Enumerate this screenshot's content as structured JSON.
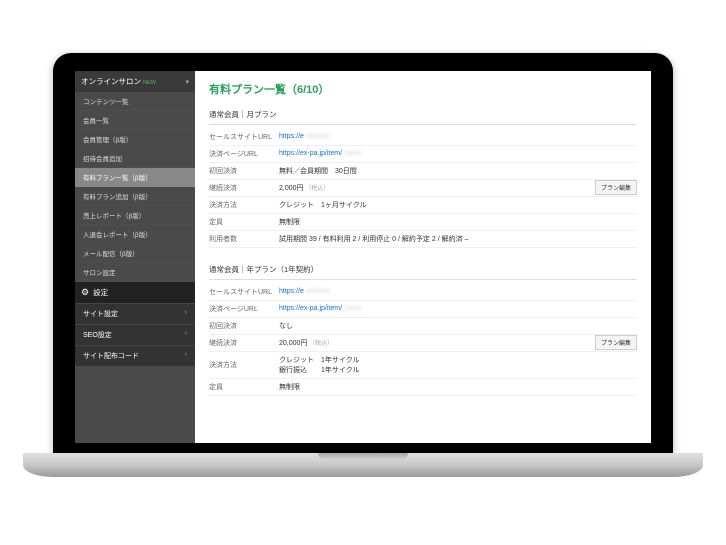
{
  "sidebar": {
    "header": "オンラインサロン",
    "new_badge": "NEW",
    "items": [
      "コンテンツ一覧",
      "会員一覧",
      "会員管理（β版）",
      "招待会員追加",
      "有料プラン一覧（β版）",
      "有料プラン追加（β版）",
      "売上レポート（β版）",
      "入退会レポート（β版）",
      "メール配信（β版）",
      "サロン設定"
    ],
    "active_index": 4
  },
  "settings": {
    "header": "設定",
    "items": [
      "サイト設定",
      "SEO設定",
      "サイト配布コード"
    ]
  },
  "page": {
    "title": "有料プラン一覧（6/10）"
  },
  "plans": [
    {
      "section_title": "通常会員｜月プラン",
      "edit_label": "プラン編集",
      "rows": [
        {
          "label": "セールスサイトURL",
          "value_link": "https://e",
          "blur": "xxxxxxx"
        },
        {
          "label": "決済ページURL",
          "value_link": "https://ex-pa.jp/item/",
          "blur": "xxxxx"
        },
        {
          "label": "初回決済",
          "value": "無料／会員期間　30日間"
        },
        {
          "label": "継続決済",
          "value": "2,000円",
          "muted": "（税込）"
        },
        {
          "label": "決済方法",
          "value": "クレジット　1ヶ月サイクル"
        },
        {
          "label": "定員",
          "value": "無制限"
        },
        {
          "label": "利用者数",
          "value": "試用期間 39 / 有料利用 2 / 利用停止 0 / 解約予定 2 / 解約済 –"
        }
      ]
    },
    {
      "section_title": "通常会員｜年プラン（1年契約）",
      "edit_label": "プラン編集",
      "rows": [
        {
          "label": "セールスサイトURL",
          "value_link": "https://e",
          "blur": "xxxxxxx"
        },
        {
          "label": "決済ページURL",
          "value_link": "https://ex-pa.jp/item/",
          "blur": "xxxxx"
        },
        {
          "label": "初回決済",
          "value": "なし"
        },
        {
          "label": "継続決済",
          "value": "20,000円",
          "muted": "（税込）"
        },
        {
          "label": "決済方法",
          "value": "クレジット　1年サイクル\n銀行振込　　1年サイクル"
        },
        {
          "label": "定員",
          "value": "無制限"
        }
      ]
    }
  ]
}
